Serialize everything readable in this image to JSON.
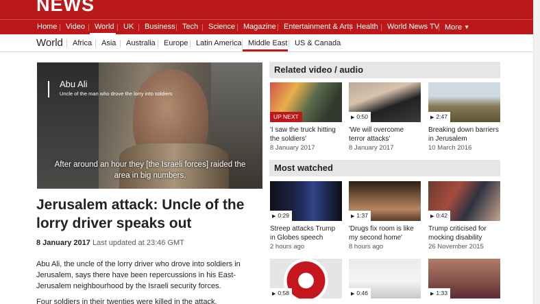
{
  "brand": "NEWS",
  "nav": [
    "Home",
    "Video",
    "World",
    "UK",
    "Business",
    "Tech",
    "Science",
    "Magazine",
    "Entertainment & Arts",
    "Health",
    "World News TV",
    "More"
  ],
  "section": {
    "title": "World",
    "items": [
      "Africa",
      "Asia",
      "Australia",
      "Europe",
      "Latin America",
      "Middle East",
      "US & Canada"
    ],
    "active": "Middle East"
  },
  "video": {
    "name": "Abu Ali",
    "description": "Uncle of the man who drove the lorry into soldiers",
    "caption": "After around an hour they [the Israeli forces] raided the area in big numbers."
  },
  "article": {
    "headline": "Jerusalem attack: Uncle of the lorry driver speaks out",
    "date": "8 January 2017",
    "updated": "Last updated at 23:46 GMT",
    "paragraph1": "Abu Ali, the uncle of the lorry driver who drove into soldiers in Jerusalem, says there have been repercussions in his East-Jerusalem neighbourhood by the Israeli security forces.",
    "paragraph2": "Four soldiers in their twenties were killed in the attack."
  },
  "related": {
    "heading": "Related video / audio",
    "items": [
      {
        "badge": "UP NEXT",
        "title": "'I saw the truck hitting the soldiers'",
        "date": "8 January 2017"
      },
      {
        "badge": "0:50",
        "title": "'We will overcome terror attacks'",
        "date": "8 January 2017"
      },
      {
        "badge": "2:47",
        "title": "Breaking down barriers in Jerusalem",
        "date": "10 March 2016"
      }
    ]
  },
  "most_watched": {
    "heading": "Most watched",
    "items": [
      {
        "badge": "0:29",
        "title": "Streep attacks Trump in Globes speech",
        "date": "2 hours ago"
      },
      {
        "badge": "1:37",
        "title": "'Drugs fix room is like my second home'",
        "date": "8 hours ago"
      },
      {
        "badge": "0:42",
        "title": "Trump criticised for mocking disability",
        "date": "26 November 2015"
      },
      {
        "badge": "0:58",
        "title": "",
        "date": ""
      },
      {
        "badge": "0:46",
        "title": "",
        "date": ""
      },
      {
        "badge": "1:33",
        "title": "",
        "date": ""
      }
    ]
  },
  "icons": {
    "play": "play-icon",
    "more_caret": "caret-down-icon"
  },
  "colors": {
    "brand_red": "#bb1919",
    "panel_grey": "#e6e6e6"
  }
}
